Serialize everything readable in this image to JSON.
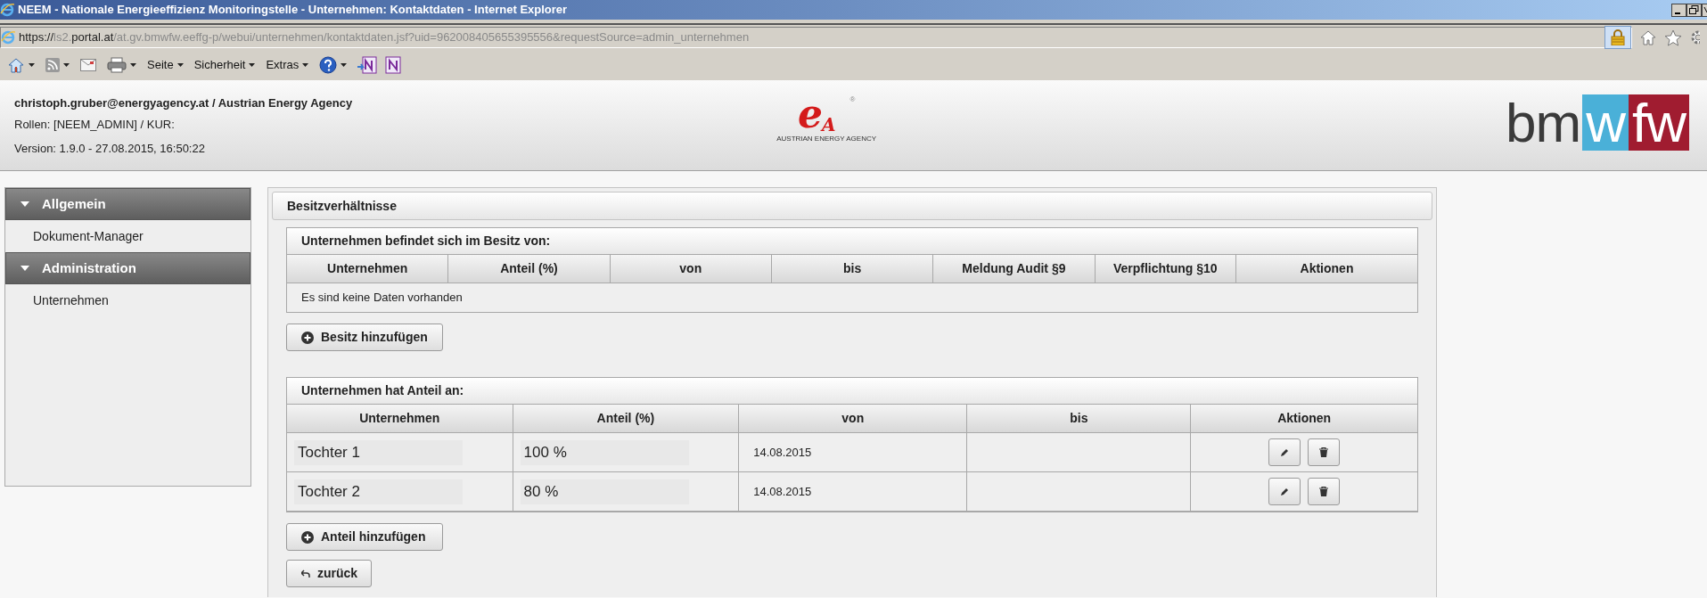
{
  "window": {
    "title": "NEEM - Nationale Energieeffizienz Monitoringstelle - Unternehmen: Kontaktdaten - Internet Explorer"
  },
  "address_bar": {
    "secure": true,
    "url_parts": [
      {
        "text": "https://",
        "strong": true
      },
      {
        "text": "ls2.",
        "strong": false
      },
      {
        "text": "portal.at",
        "strong": true
      },
      {
        "text": "/at.gv.bmwfw.eeffg-p/webui/unternehmen/kontaktdaten.jsf?uid=962008405655395556&requestSource=admin_unternehmen",
        "strong": false
      }
    ]
  },
  "toolbar": {
    "menus": [
      "Seite",
      "Sicherheit",
      "Extras"
    ]
  },
  "header": {
    "user": "christoph.gruber@energyagency.at / Austrian Energy Agency",
    "roles": "Rollen: [NEEM_ADMIN] / KUR:",
    "version": "Version: 1.9.0 - 27.08.2015, 16:50:22",
    "center_logo": {
      "letters": [
        "e",
        "A"
      ],
      "mark": "®",
      "caption": "AUSTRIAN ENERGY AGENCY"
    },
    "right_logo": {
      "parts": [
        "bm",
        "w",
        "fw"
      ]
    }
  },
  "sidebar": {
    "sections": [
      {
        "title": "Allgemein",
        "expanded": true,
        "items": [
          "Dokument-Manager"
        ]
      },
      {
        "title": "Administration",
        "expanded": true,
        "items": [
          "Unternehmen"
        ]
      }
    ]
  },
  "panel": {
    "title": "Besitzverhältnisse",
    "owners_table": {
      "caption": "Unternehmen befindet sich im Besitz von:",
      "columns": [
        "Unternehmen",
        "Anteil (%)",
        "von",
        "bis",
        "Meldung Audit §9",
        "Verpflichtung §10",
        "Aktionen"
      ],
      "empty_message": "Es sind keine Daten vorhanden"
    },
    "add_owner_button": "Besitz hinzufügen",
    "holdings_table": {
      "caption": "Unternehmen hat Anteil an:",
      "columns": [
        "Unternehmen",
        "Anteil (%)",
        "von",
        "bis",
        "Aktionen"
      ],
      "rows": [
        {
          "company": "Tochter 1",
          "share": "100 %",
          "von": "14.08.2015"
        },
        {
          "company": "Tochter 2",
          "share": "80 %",
          "von": "14.08.2015"
        }
      ]
    },
    "add_share_button": "Anteil hinzufügen",
    "back_button": "zurück"
  }
}
